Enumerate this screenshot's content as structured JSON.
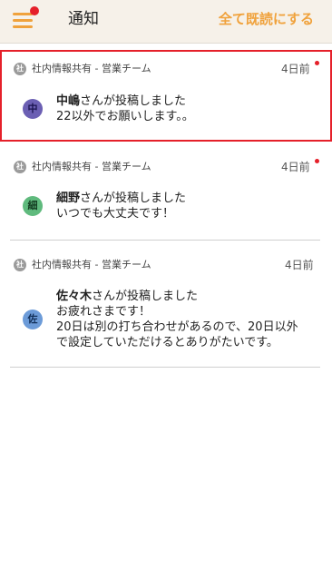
{
  "header": {
    "title": "通知",
    "mark_all_read": "全て既読にする",
    "menu_badge_color": "#e5202a",
    "accent_color": "#f0a23c"
  },
  "notifications": [
    {
      "channel_badge": "社",
      "channel_name": "社内情報共有 - 営業チーム",
      "time": "4日前",
      "unread": true,
      "avatar_char": "中",
      "avatar_color": "#6b5fb3",
      "author": "中嶋",
      "action": "さんが投稿しました",
      "lines": [
        "22以外でお願いします。。"
      ]
    },
    {
      "channel_badge": "社",
      "channel_name": "社内情報共有 - 営業チーム",
      "time": "4日前",
      "unread": true,
      "avatar_char": "細",
      "avatar_color": "#5fba7d",
      "author": "細野",
      "action": "さんが投稿しました",
      "lines": [
        "いつでも大丈夫です！"
      ]
    },
    {
      "channel_badge": "社",
      "channel_name": "社内情報共有 - 営業チーム",
      "time": "4日前",
      "unread": false,
      "avatar_char": "佐",
      "avatar_color": "#6c9bd8",
      "author": "佐々木",
      "action": "さんが投稿しました",
      "lines": [
        "お疲れさまです！",
        "20日は別の打ち合わせがあるので、20日以外",
        "で設定していただけるとありがたいです。"
      ]
    }
  ]
}
